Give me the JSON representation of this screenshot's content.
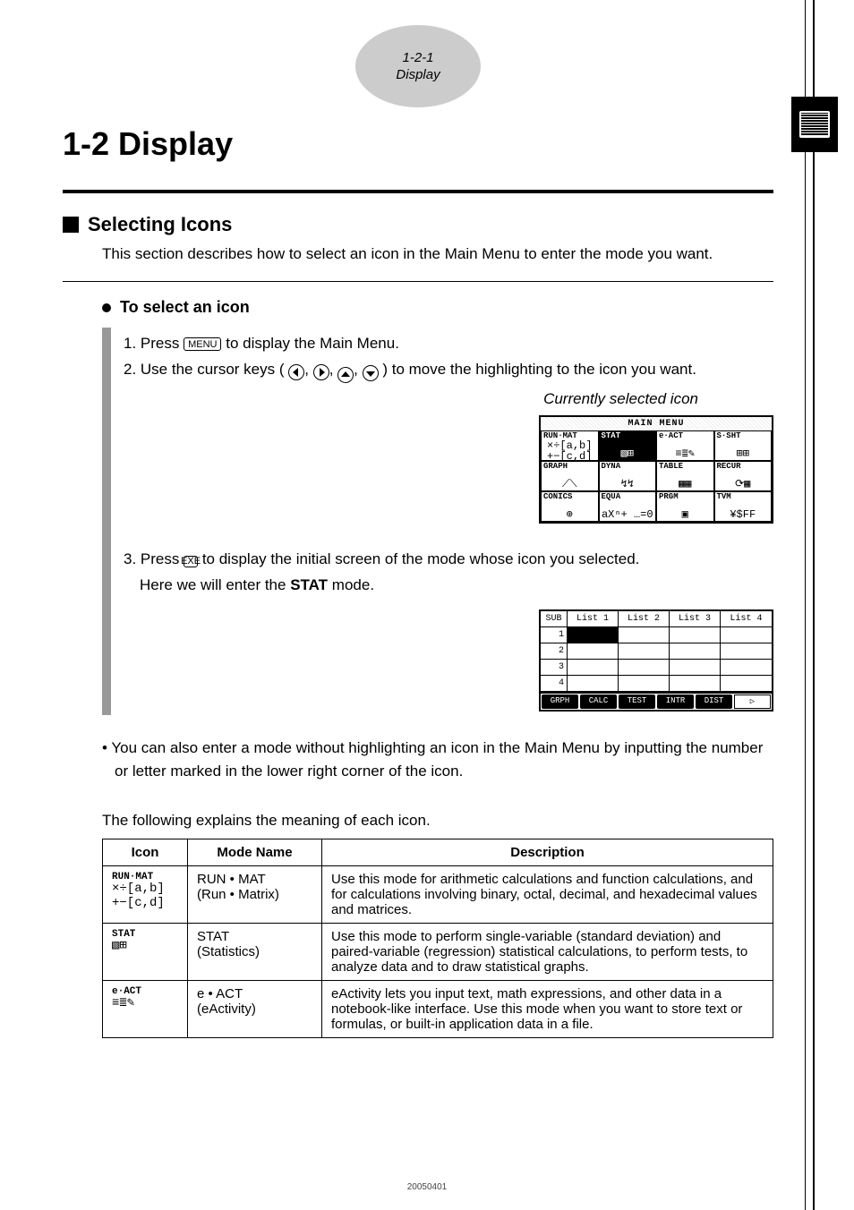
{
  "header": {
    "line1": "1-2-1",
    "line2": "Display"
  },
  "title": "1-2  Display",
  "section": {
    "heading": "Selecting Icons",
    "intro": "This section describes how to select an icon in the Main Menu to enter the mode you want."
  },
  "procedure": {
    "heading": "To select an icon",
    "steps": {
      "s1_pre": "1. Press ",
      "s1_key": "MENU",
      "s1_post": " to display the Main Menu.",
      "s2_pre": "2. Use the cursor keys (",
      "s2_sep": ", ",
      "s2_post": ") to move the highlighting to the icon you want.",
      "caption": "Currently selected icon",
      "s3_pre": "3. Press ",
      "s3_key": "EXE",
      "s3_mid": " to display the initial screen of the mode whose icon you selected.",
      "s3_line2_pre": "Here we will enter the ",
      "s3_stat": "STAT",
      "s3_line2_post": " mode."
    }
  },
  "menu": {
    "title": "MAIN  MENU",
    "cells": [
      {
        "label": "RUN·MAT",
        "glyph": "×÷[a,b]\n+−[c,d]"
      },
      {
        "label": "STAT",
        "glyph": "▧⊞",
        "selected": true
      },
      {
        "label": "e·ACT",
        "glyph": "≡≣✎"
      },
      {
        "label": "S·SHT",
        "glyph": "⊞⊞"
      },
      {
        "label": "GRAPH",
        "glyph": "⟋⟍"
      },
      {
        "label": "DYNA",
        "glyph": "↯↯"
      },
      {
        "label": "TABLE",
        "glyph": "▦▦"
      },
      {
        "label": "RECUR",
        "glyph": "⟳▦"
      },
      {
        "label": "CONICS",
        "glyph": "⊕"
      },
      {
        "label": "EQUA",
        "glyph": "aXⁿ+\n…=0"
      },
      {
        "label": "PRGM",
        "glyph": "▣"
      },
      {
        "label": "TVM",
        "glyph": "¥$FF"
      }
    ]
  },
  "stat": {
    "sub": "SUB",
    "cols": [
      "List 1",
      "List 2",
      "List 3",
      "List 4"
    ],
    "rows": [
      "1",
      "2",
      "3",
      "4"
    ],
    "softkeys": [
      "GRPH",
      "CALC",
      "TEST",
      "INTR",
      "DIST",
      "▷"
    ]
  },
  "note": "• You can also enter a mode without highlighting an icon in the Main Menu by inputting the number or letter marked in the lower right corner of the icon.",
  "lead": "The following explains the meaning of each icon.",
  "table": {
    "head": [
      "Icon",
      "Mode Name",
      "Description"
    ],
    "rows": [
      {
        "icon_label": "RUN·MAT",
        "icon_art": "×÷[a,b]\n+−[c,d]",
        "mode": "RUN • MAT\n(Run • Matrix)",
        "desc": "Use this mode for arithmetic calculations and function calculations, and for calculations involving binary, octal, decimal, and hexadecimal values and matrices."
      },
      {
        "icon_label": "STAT",
        "icon_art": "▧⊞",
        "mode": "STAT\n(Statistics)",
        "desc": "Use this mode to perform single-variable (standard deviation) and paired-variable (regression) statistical calculations, to perform tests, to analyze data and to draw statistical graphs."
      },
      {
        "icon_label": "e·ACT",
        "icon_art": "≡≣✎",
        "mode": "e • ACT\n(eActivity)",
        "desc": "eActivity lets you input text, math expressions, and other data in a notebook-like interface. Use this mode when you want to store text or formulas, or built-in application data in a file."
      }
    ]
  },
  "footer": "20050401"
}
